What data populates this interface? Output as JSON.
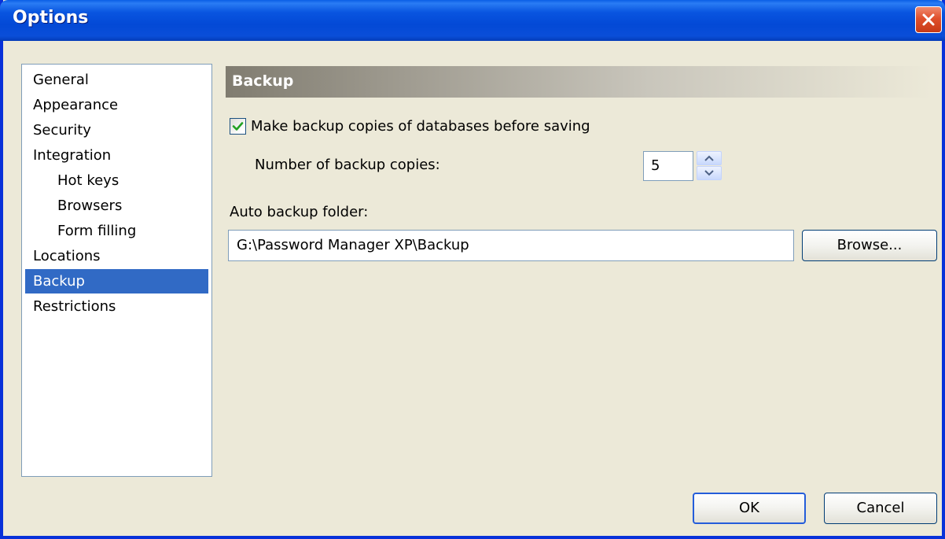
{
  "window": {
    "title": "Options"
  },
  "sidebar": {
    "items": [
      {
        "label": "General",
        "level": 0,
        "selected": false
      },
      {
        "label": "Appearance",
        "level": 0,
        "selected": false
      },
      {
        "label": "Security",
        "level": 0,
        "selected": false
      },
      {
        "label": "Integration",
        "level": 0,
        "selected": false
      },
      {
        "label": "Hot keys",
        "level": 1,
        "selected": false
      },
      {
        "label": "Browsers",
        "level": 1,
        "selected": false
      },
      {
        "label": "Form filling",
        "level": 1,
        "selected": false
      },
      {
        "label": "Locations",
        "level": 0,
        "selected": false
      },
      {
        "label": "Backup",
        "level": 0,
        "selected": true
      },
      {
        "label": "Restrictions",
        "level": 0,
        "selected": false
      }
    ]
  },
  "section": {
    "title": "Backup"
  },
  "backup": {
    "make_copies_label": "Make backup copies of databases before saving",
    "make_copies_checked": true,
    "copies_label": "Number of backup copies:",
    "copies_value": "5",
    "folder_label": "Auto backup folder:",
    "folder_value": "G:\\Password Manager XP\\Backup",
    "browse_label": "Browse..."
  },
  "footer": {
    "ok_label": "OK",
    "cancel_label": "Cancel"
  },
  "colors": {
    "title_bar": "#0a4ed8",
    "selection": "#316ac5",
    "dialog_background": "#ece9d8",
    "close_button": "#e0502c",
    "checkmark": "#21a121"
  },
  "icons": {
    "close": "close-icon",
    "check": "checkmark-icon",
    "spin_up": "chevron-up-icon",
    "spin_down": "chevron-down-icon"
  }
}
